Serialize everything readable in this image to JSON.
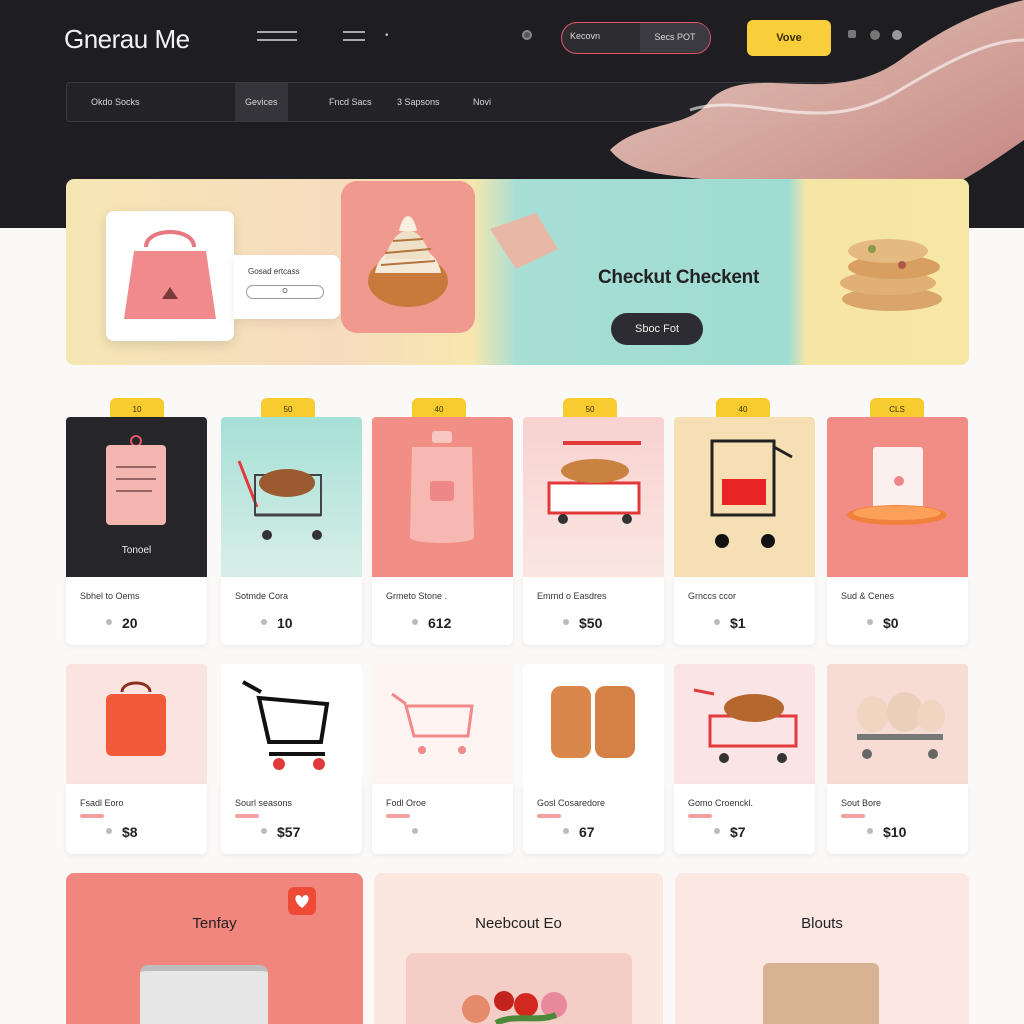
{
  "header": {
    "brand": "Gnerau Me",
    "search": {
      "left_text": "Kecovn",
      "right_text": "Secs POT"
    },
    "cta_label": "Vove",
    "nav": [
      "Okdo Socks",
      "Gevices",
      "Fncd Sacs",
      "3 Sapsons",
      "Novi"
    ]
  },
  "hero": {
    "card_title": "Gosad ertcass",
    "input_text": "O",
    "title": "Checkut Checkent",
    "button_label": "Sboc Fot"
  },
  "products_row1": [
    {
      "badge": "10",
      "label": "Tonoel",
      "name": "Sbhel to Oems",
      "price": "20"
    },
    {
      "badge": "50",
      "label": "",
      "name": "Sotmde Cora",
      "price": "10"
    },
    {
      "badge": "40",
      "label": "",
      "name": "Grmeto Stone .",
      "price": "612"
    },
    {
      "badge": "50",
      "label": "",
      "name": "Emrnd o Easdres",
      "price": "$50"
    },
    {
      "badge": "40",
      "label": "",
      "name": "Grnccs ccor",
      "price": "$1"
    },
    {
      "badge": "CLS",
      "label": "",
      "name": "Sud & Cenes",
      "price": "$0"
    }
  ],
  "products_row2": [
    {
      "name": "Fsadl Eoro",
      "price": "$8"
    },
    {
      "name": "Sourl seasons",
      "price": "$57"
    },
    {
      "name": "Fodl Oroe",
      "price": ""
    },
    {
      "name": "Gosl Cosaredore",
      "price": "67"
    },
    {
      "name": "Gomo Croenckl.",
      "price": "$7"
    },
    {
      "name": "Sout Bore",
      "price": "$10"
    }
  ],
  "categories": [
    {
      "title": "Tenfay"
    },
    {
      "title": "Neebcout Eo"
    },
    {
      "title": "Blouts"
    }
  ],
  "colors": {
    "header_bg": "#1e1e22",
    "accent_yellow": "#f8cf3a",
    "accent_pink": "#f09a8f",
    "accent_mint": "#a7ded5"
  }
}
